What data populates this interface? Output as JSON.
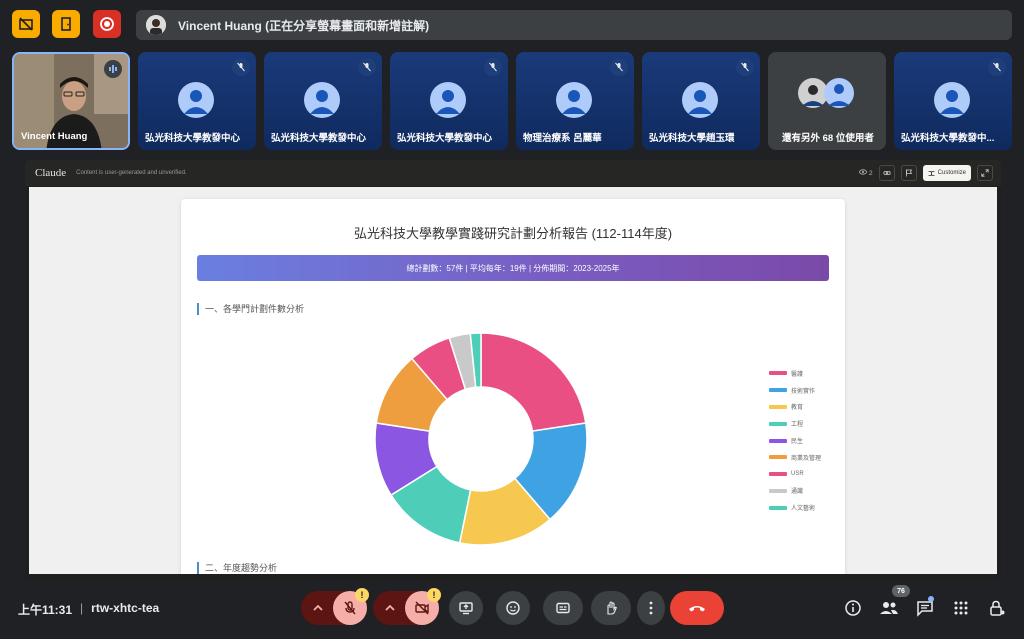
{
  "presenter": {
    "name_status": "Vincent Huang (正在分享螢幕畫面和新增註解)"
  },
  "tiles": [
    {
      "name": "Vincent Huang"
    },
    {
      "name": "弘光科技大學教發中心"
    },
    {
      "name": "弘光科技大學教發中心"
    },
    {
      "name": "弘光科技大學教發中心"
    },
    {
      "name": "物理治療系 呂麗華"
    },
    {
      "name": "弘光科技大學趙玉環"
    },
    {
      "name": "還有另外 68 位使用者"
    },
    {
      "name": "弘光科技大學教發中..."
    }
  ],
  "share": {
    "app": "Claude",
    "note": "Content is user-generated and unverified.",
    "views": "2",
    "customize": "Customize"
  },
  "report": {
    "title": "弘光科技大學教學實踐研究計劃分析報告 (112-114年度)",
    "stats": "總計劃數：57件 | 平均每年：19件 | 分佈期間：2023-2025年",
    "section1": "一、各學門計劃件數分析",
    "section2": "二、年度趨勢分析"
  },
  "chart_data": {
    "type": "pie",
    "donut": true,
    "categories": [
      "醫護",
      "技術實作",
      "教育",
      "工程",
      "民生",
      "商業及管理",
      "USR",
      "通識",
      "人文藝術"
    ],
    "values": [
      14,
      10,
      9,
      8,
      7,
      7,
      4,
      2,
      1
    ],
    "colors": [
      "#e94f82",
      "#3fa3e3",
      "#f7c84f",
      "#4ecdb8",
      "#8a56e2",
      "#ee9e3e",
      "#e94f82",
      "#c9c9c9",
      "#4ecdb8"
    ],
    "legend": "right"
  },
  "bottom": {
    "time": "上午11:31",
    "meeting_code": "rtw-xhtc-tea",
    "participants_count": "76"
  },
  "colors": {
    "accent": "#8ab4f8",
    "danger": "#ea4335",
    "warning": "#fdd663"
  }
}
